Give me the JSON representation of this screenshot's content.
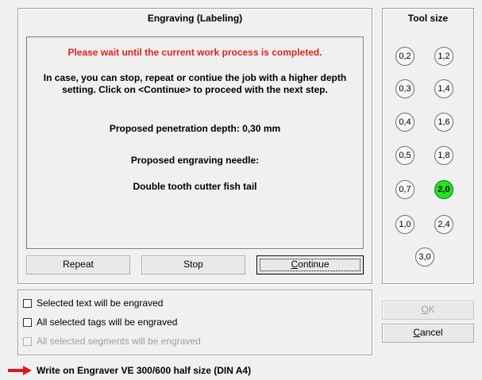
{
  "engraving": {
    "title": "Engraving (Labeling)",
    "warning": "Please wait until the current work process is completed.",
    "info_line1": "In case, you can stop, repeat or contiue the job with a higher depth",
    "info_line2": "setting. Click on <Continue> to proceed with the next step.",
    "penetration": "Proposed penetration depth: 0,30 mm",
    "needle_label": "Proposed engraving needle:",
    "needle_value": "Double tooth cutter fish tail",
    "buttons": {
      "repeat": "Repeat",
      "stop": "Stop",
      "continue_pre": "",
      "continue_mn": "C",
      "continue_post": "ontinue"
    }
  },
  "tool_size": {
    "title": "Tool size",
    "selected": "2,0",
    "sizes": [
      "0,2",
      "1,2",
      "0,3",
      "1,4",
      "0,4",
      "1,6",
      "0,5",
      "1,8",
      "0,7",
      "2,0",
      "1,0",
      "2,4",
      "3,0"
    ]
  },
  "options": [
    {
      "label": "Selected text will be engraved",
      "checked": false,
      "enabled": true
    },
    {
      "label": "All selected tags will be engraved",
      "checked": false,
      "enabled": true
    },
    {
      "label": "All selected segments will be engraved",
      "checked": false,
      "enabled": false
    }
  ],
  "actions": {
    "ok_mn": "O",
    "ok_post": "K",
    "cancel_mn": "C",
    "cancel_post": "ancel"
  },
  "status": {
    "text": "Write on Engraver VE 300/600 half size (DIN A4)",
    "arrow_color": "#d9171b"
  }
}
